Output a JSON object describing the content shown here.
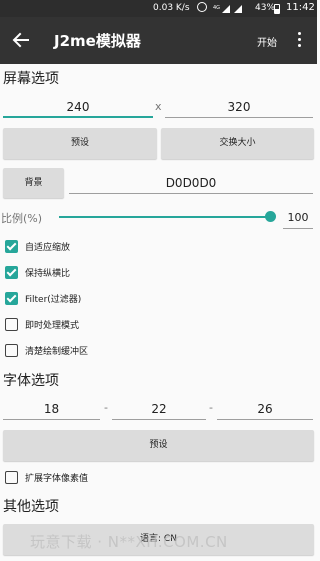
{
  "status_bar": {
    "net_speed": "0.03 K/s",
    "network": "4G",
    "battery": "43%",
    "time": "11:42"
  },
  "appbar": {
    "title": "J2me模拟器",
    "start_label": "开始"
  },
  "screen_options": {
    "title": "屏幕选项",
    "width": "240",
    "separator": "x",
    "height": "320",
    "preset_label": "预设",
    "swap_label": "交换大小",
    "background_label": "背景",
    "background_value": "D0D0D0",
    "scale_label": "比例(%)",
    "scale_value": "100",
    "checkboxes": [
      {
        "label": "自适应缩放",
        "checked": true
      },
      {
        "label": "保持纵横比",
        "checked": true
      },
      {
        "label": "Filter(过滤器)",
        "checked": true
      },
      {
        "label": "即时处理模式",
        "checked": false
      },
      {
        "label": "清楚绘制缓冲区",
        "checked": false
      }
    ]
  },
  "font_options": {
    "title": "字体选项",
    "small": "18",
    "medium": "22",
    "large": "26",
    "separator": "-",
    "preset_label": "预设",
    "expand_label": "扩展字体像素值",
    "expand_checked": false
  },
  "other_options": {
    "title": "其他选项",
    "language_label": "语言: CN"
  },
  "watermark": "玩意下载 · N**XH.COM.CN",
  "colors": {
    "accent": "#26a69a",
    "appbar": "#333333",
    "statusbar": "#2d2d2d",
    "button": "#dcdcdc"
  }
}
